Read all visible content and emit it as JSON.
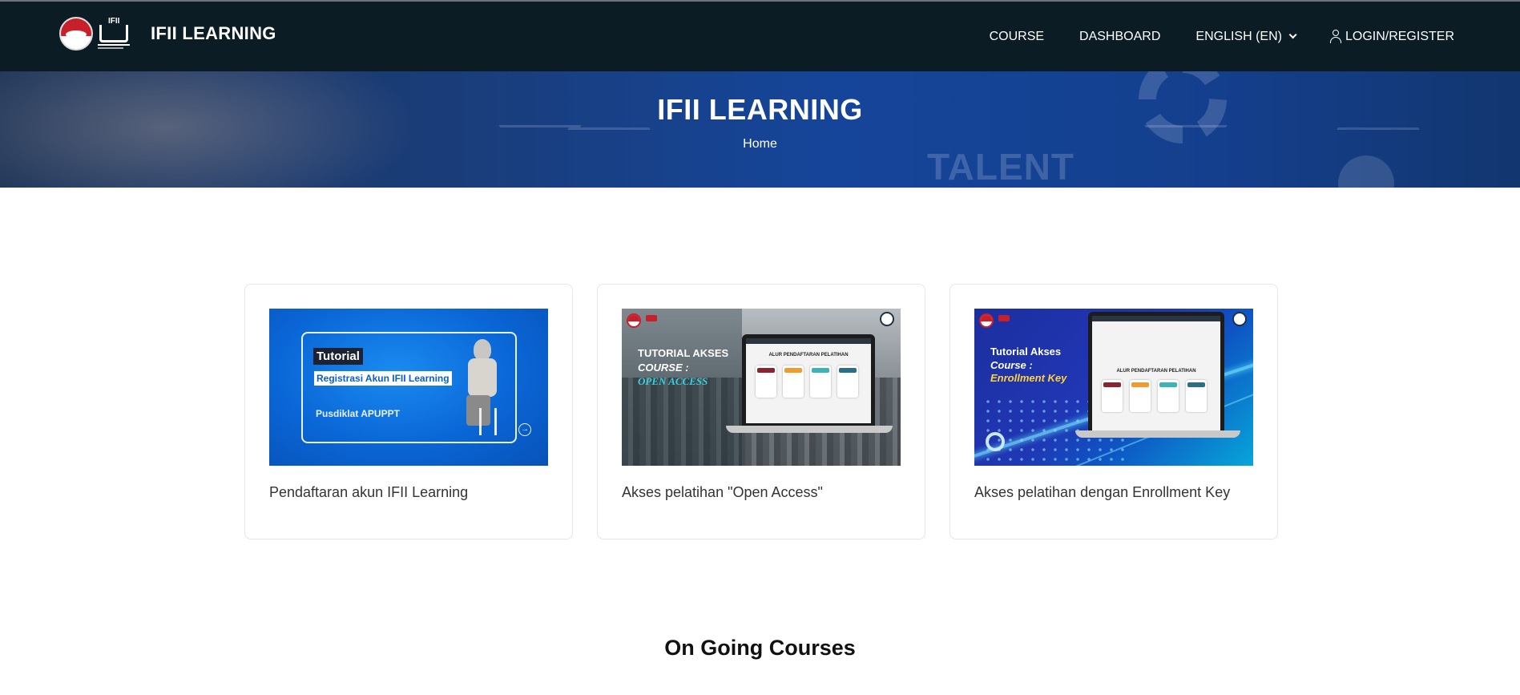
{
  "navbar": {
    "brand_name": "IFII LEARNING",
    "logo_text": "IFII",
    "menu": {
      "course": "COURSE",
      "dashboard": "DASHBOARD",
      "language": "ENGLISH (EN)",
      "login": "LOGIN/REGISTER"
    }
  },
  "hero": {
    "title": "IFII LEARNING",
    "breadcrumb": "Home",
    "background_word": "TALENT"
  },
  "cards": [
    {
      "caption": "Pendaftaran akun IFII Learning",
      "thumb": {
        "line1": "Tutorial",
        "line2": "Registrasi Akun IFII Learning",
        "line3": "Pusdiklat APUPPT"
      }
    },
    {
      "caption": "Akses pelatihan \"Open Access\"",
      "thumb": {
        "line1": "TUTORIAL AKSES",
        "line2": "COURSE :",
        "line3": "OPEN ACCESS",
        "screen_title": "ALUR PENDAFTARAN PELATIHAN"
      }
    },
    {
      "caption": "Akses pelatihan dengan Enrollment Key",
      "thumb": {
        "line1": "Tutorial Akses",
        "line2": "Course :",
        "line3": "Enrollment Key",
        "screen_title": "ALUR PENDAFTARAN PELATIHAN"
      }
    }
  ],
  "sections": {
    "ongoing_title": "On Going Courses"
  },
  "colors": {
    "navbar_bg": "#0b1c25",
    "hero_bg": "#15459a",
    "brand_red": "#c8202a"
  }
}
